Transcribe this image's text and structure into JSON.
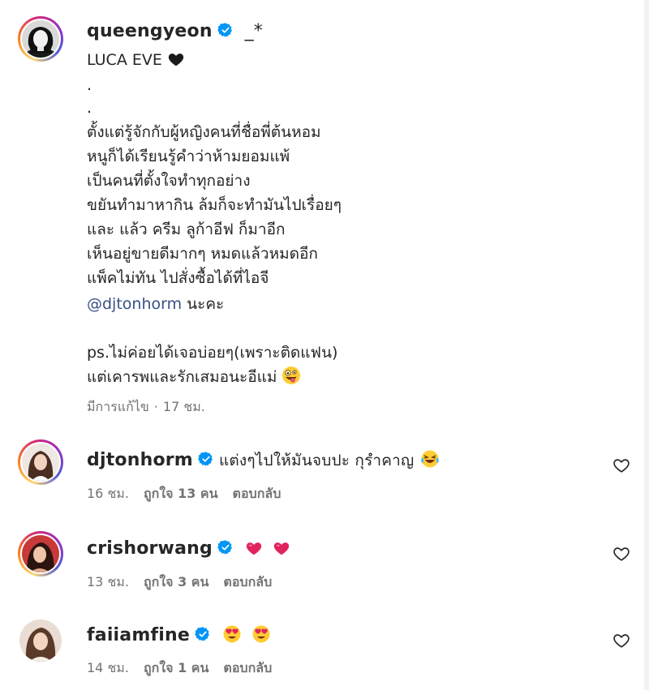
{
  "post": {
    "username": "queengyeon",
    "username_suffix": "_*",
    "caption_lines": [
      "LUCA EVE",
      ".",
      ".",
      "ตั้งแต่รู้จักกับผู้หญิงคนที่ชื่อพี่ต้นหอม",
      "หนูก็ได้เรียนรู้คำว่าห้ามยอมแพ้",
      "เป็นคนที่ตั้งใจทำทุกอย่าง",
      "ขยันทำมาหากิน ล้มก็จะทำมันไปเรื่อยๆ",
      "และ แล้ว ครีม ลูก้าอีฟ ก็มาอีก",
      "เห็นอยู่ขายดีมากๆ หมดแล้วหมดอีก",
      "แพ็คไม่ทัน ไปสั่งซื้อได้ที่ไอจี",
      "",
      "ps.ไม่ค่อยได้เจอบ่อยๆ(เพราะติดแฟน)",
      "แต่เคารพและรักเสมอนะอีแม่"
    ],
    "mention": "@djtonhorm",
    "mention_suffix": "นะคะ",
    "edited_label": "มีการแก้ไข",
    "time": "17 ชม.",
    "meta_separator": "·"
  },
  "comments": [
    {
      "username": "djtonhorm",
      "text": "แต่งๆไปให้มันจบปะ กุรำคาญ",
      "emoji": "laughing-crying-emoji",
      "time": "16 ชม.",
      "likes": "ถูกใจ 13 คน",
      "reply": "ตอบกลับ",
      "has_story_ring": true
    },
    {
      "username": "crishorwang",
      "text": "",
      "emoji": "red-heart-emoji x2",
      "time": "13 ชม.",
      "likes": "ถูกใจ 3 คน",
      "reply": "ตอบกลับ",
      "has_story_ring": true
    },
    {
      "username": "faiiamfine",
      "text": "",
      "emoji": "heart-eyes-emoji x2",
      "time": "14 ชม.",
      "likes": "ถูกใจ 1 คน",
      "reply": "ตอบกลับ",
      "has_story_ring": false
    }
  ],
  "colors": {
    "verified": "#0095f6",
    "meta_text": "#737373",
    "mention": "#385185",
    "heart_red": "#e0245e"
  }
}
